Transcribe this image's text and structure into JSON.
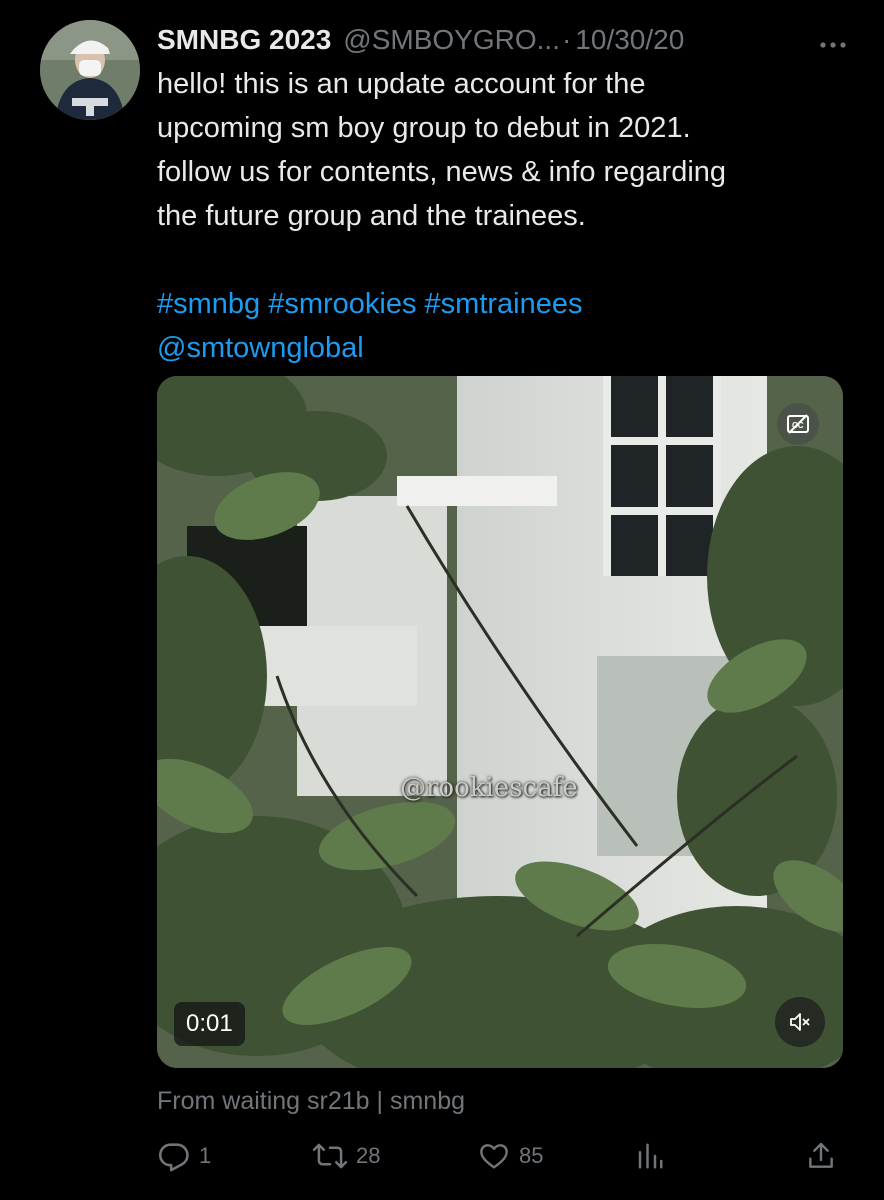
{
  "tweet": {
    "display_name": "SMNBG 2023",
    "handle": "@SMBOYGRO...",
    "separator": "·",
    "date": "10/30/20",
    "more_icon": "more-horizontal-icon",
    "text_lines": [
      "hello! this is an update account for the",
      "upcoming sm boy group to debut in 2021.",
      "follow us for contents, news & info regarding",
      "the future group and the trainees."
    ],
    "hashtags": "#smnbg #smrookies #smtrainees",
    "mention": "@smtownglobal",
    "media": {
      "watermark": "@rookiescafe",
      "timestamp": "0:01",
      "captions_icon": "closed-captions-off-icon",
      "mute_icon": "volume-muted-icon"
    },
    "source": "From waiting sr21b | smnbg",
    "actions": {
      "reply_count": "1",
      "retweet_count": "28",
      "like_count": "85"
    }
  },
  "colors": {
    "background": "#000000",
    "text": "#e7e9ea",
    "muted": "#71767b",
    "link": "#1d9bf0"
  }
}
